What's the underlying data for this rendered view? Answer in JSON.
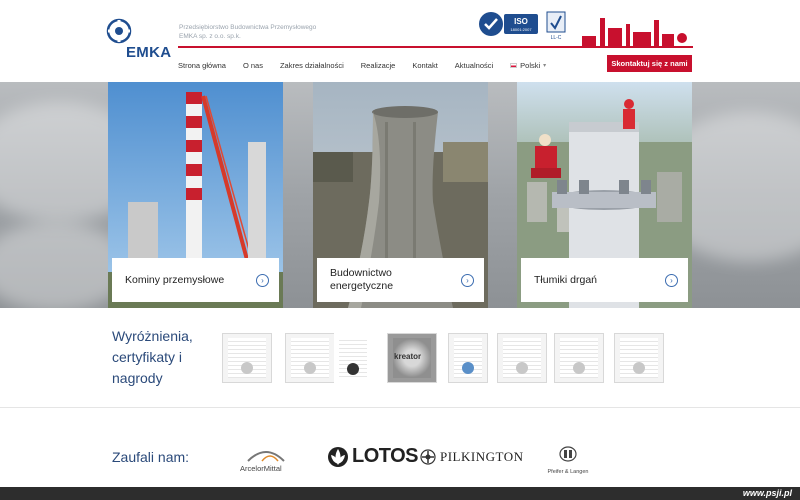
{
  "header": {
    "logo_text": "EMKA",
    "tagline_line1": "Przedsiębiorstwo Budownictwa Przemysłowego",
    "tagline_line2": "EMKA sp. z o.o. sp.k.",
    "iso_text": "ISO",
    "iso_sub": "18001:2007",
    "cert_text": "LL-C"
  },
  "nav": {
    "items": [
      {
        "label": "Strona główna"
      },
      {
        "label": "O nas"
      },
      {
        "label": "Zakres działalności"
      },
      {
        "label": "Realizacje"
      },
      {
        "label": "Kontakt"
      },
      {
        "label": "Aktualności"
      }
    ],
    "language": "Polski",
    "contact_button": "Skontaktuj się z nami"
  },
  "hero": {
    "tiles": [
      {
        "title": "Kominy przemysłowe"
      },
      {
        "title": "Budownictwo energetyczne"
      },
      {
        "title": "Tłumiki drgań"
      }
    ]
  },
  "awards": {
    "title": "Wyróżnienia, certyfikaty i nagrody",
    "badge_text": "kreator"
  },
  "partners": {
    "title": "Zaufali nam:",
    "logos": {
      "arcelor": "ArcelorMittal",
      "lotos": "LOTOS",
      "pilkington": "PILKINGTON",
      "pfeifer": "Pfeifer & Langen"
    }
  },
  "footer": {
    "site": "www.psji.pl"
  },
  "colors": {
    "brand_blue": "#1f4d8f",
    "accent_red": "#c8102e",
    "heading_blue": "#2b4a7a"
  }
}
